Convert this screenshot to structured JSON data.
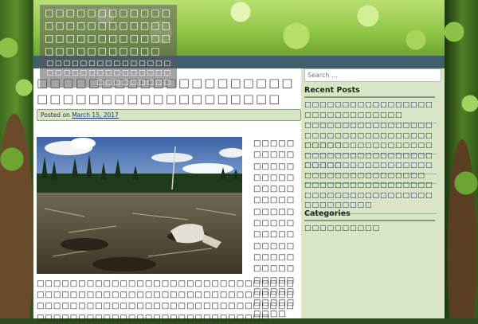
{
  "site": {
    "title": "□□□□□□□□□□□□□□□□□□□□□□□□□□□□□□□□□□□□□□□□□□□□□□□",
    "description": "□□□□□□□□□□□□□□□□□□□□□□□□□□□□□□□□□□□□□□□"
  },
  "post": {
    "title": "□□□□□□□□□□□□□□□□□□□□□□□□□□□□□□□□□□□□□□□",
    "posted_prefix": "Posted on",
    "posted_date": "March 15, 2017",
    "side_text": "□□□□□□□□□□□□□□□□□□□□□□□□□□□□□□□□□□□□□□□□□□□□□□□□□□□□□□□□□□□□□□□□□□□□□□□□□□□□□□□",
    "body_text": "□□□□□□□□□□□□□□□□□□□□□□□□□□□□□□□□□□□□□□□□□□□□□□□□□□□□□□□□□□□□□□□□□□□□□□□□□□□□□□□□□□□□□□□□□□□□□□□□□□□□□□□□□□□□□□□□□□□□□□□□□"
  },
  "sidebar": {
    "search_placeholder": "Search …",
    "recent_posts_title": "Recent Posts",
    "recent_posts": [
      "□□□□□□□□□□□□□□□□□□□□□□□□□□□□□□",
      "□□□□□□□□□□□□□□□□□□□□□□□□□□□□□□□□□□□□□□□",
      "□□□□□□□□□□□□□□□□□□□□□□□□□□□□□□□□□□□□□□□",
      "□□□□□□□□□□□□□□□□□□□□□□□□□□□□□□□□□",
      "□□□□□□□□□□□□□□□□□□□□□□□□□□□□□□□□□□□□□□□□□□□"
    ],
    "categories_title": "Categories",
    "categories": [
      "□□□□□□□□□□"
    ]
  },
  "colors": {
    "nav_bar": "#3f5f6f",
    "content_bg": "#d9e5c7",
    "posted_box_bg": "#d5e4c2",
    "link": "#1f3a8a"
  }
}
